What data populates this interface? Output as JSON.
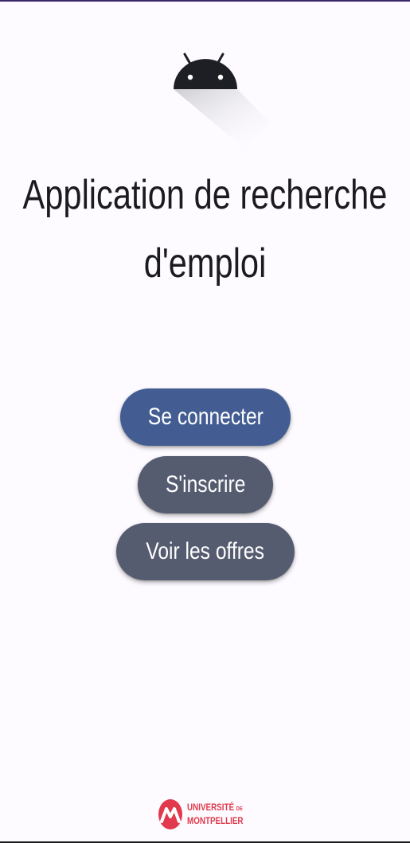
{
  "app": {
    "title_line1": "Application de recherche",
    "title_line2": "d'emploi",
    "logo_icon": "android-icon"
  },
  "actions": {
    "login_label": "Se connecter",
    "signup_label": "S'inscrire",
    "offers_label": "Voir les offres"
  },
  "footer": {
    "university_line1": "UNIVERSITÉ",
    "university_de": "DE",
    "university_line2": "MONTPELLIER",
    "logo_icon": "universite-montpellier-logo"
  },
  "colors": {
    "background": "#fdfbff",
    "primary_button": "#435d93",
    "secondary_button": "#565c70",
    "brand_red": "#e03a4c"
  }
}
